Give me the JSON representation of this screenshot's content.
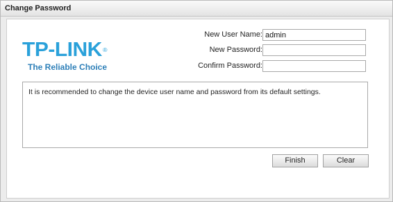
{
  "window": {
    "title": "Change Password"
  },
  "logo": {
    "brand": "TP-LINK",
    "registered": "®",
    "tagline": "The Reliable Choice"
  },
  "form": {
    "username": {
      "label": "New User Name:",
      "value": "admin"
    },
    "password": {
      "label": "New Password:",
      "value": ""
    },
    "confirm": {
      "label": "Confirm Password:",
      "value": ""
    }
  },
  "message": {
    "text": "It is recommended to change the device user name and password from its default settings."
  },
  "buttons": {
    "finish": "Finish",
    "clear": "Clear"
  }
}
